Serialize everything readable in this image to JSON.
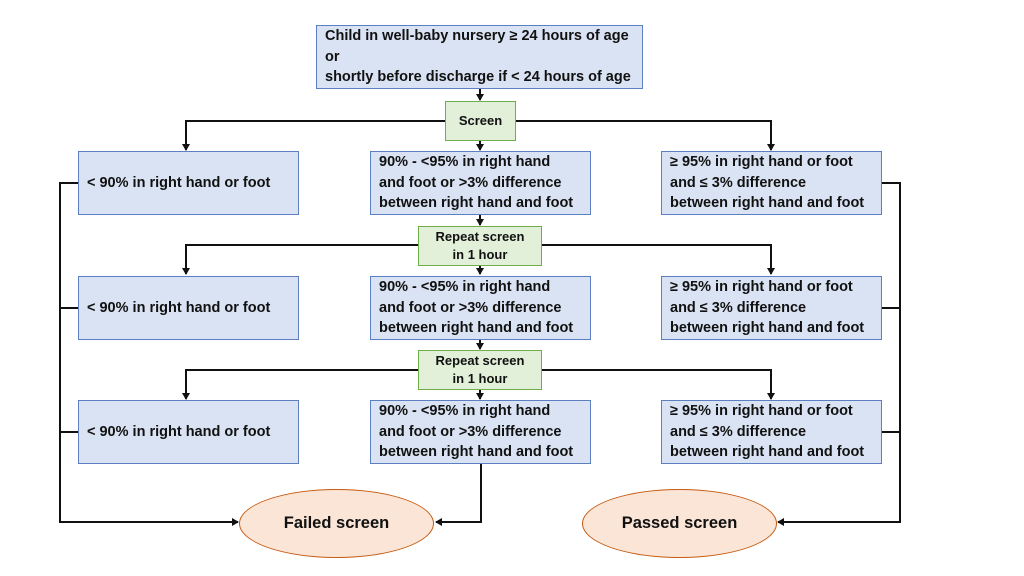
{
  "diagram": {
    "start": "Child in well-baby nursery ≥ 24 hours of age or\nshortly before discharge if < 24 hours of age",
    "screen": "Screen",
    "repeat_1": "Repeat screen\nin 1 hour",
    "repeat_2": "Repeat screen\nin 1 hour",
    "rows": [
      {
        "fail": "< 90% in right hand or foot",
        "mid": "90% - <95% in right hand\nand foot or >3% difference\nbetween right hand and foot",
        "pass": "≥ 95% in right hand or foot\nand ≤ 3% difference\nbetween right hand and foot"
      },
      {
        "fail": "< 90% in right hand or foot",
        "mid": "90% - <95% in right hand\nand foot or >3% difference\nbetween right hand and foot",
        "pass": "≥ 95% in right hand or foot\nand ≤ 3% difference\nbetween right hand and foot"
      },
      {
        "fail": "< 90% in right hand or foot",
        "mid": "90% - <95% in right hand\nand foot or >3% difference\nbetween right hand and foot",
        "pass": "≥ 95% in right hand or foot\nand ≤ 3% difference\nbetween right hand and foot"
      }
    ],
    "failed": "Failed screen",
    "passed": "Passed screen"
  }
}
